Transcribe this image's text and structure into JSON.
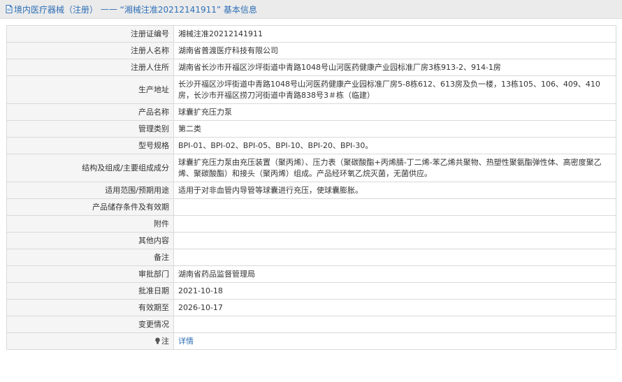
{
  "header": {
    "prefix": "境内医疗器械（注册）",
    "separator": " —— ",
    "title": "“湘械注准20212141911” 基本信息"
  },
  "rows": [
    {
      "label": "注册证编号",
      "value": "湘械注准20212141911"
    },
    {
      "label": "注册人名称",
      "value": "湖南省普渡医疗科技有限公司"
    },
    {
      "label": "注册人住所",
      "value": "湖南省长沙市开福区沙坪街道中青路1048号山河医药健康产业园标准厂房3栋913-2、914-1房"
    },
    {
      "label": "生产地址",
      "value": "长沙开福区沙坪街道中青路1048号山河医药健康产业园标准厂房5-8栋612、613房及负一楼，13栋105、106、409、410房，长沙市开福区捞刀河街道中青路838号3＃栋（临建）"
    },
    {
      "label": "产品名称",
      "value": "球囊扩充压力泵"
    },
    {
      "label": "管理类别",
      "value": "第二类"
    },
    {
      "label": "型号规格",
      "value": "BPI-01、BPI-02、BPI-05、BPI-10、BPI-20、BPI-30。"
    },
    {
      "label": "结构及组成/主要组成成分",
      "value": "球囊扩充压力泵由充压装置（聚丙烯）、压力表（聚碳酸酯+丙烯腈-丁二烯-苯乙烯共聚物、热塑性聚氨酯弹性体、高密度聚乙烯、聚碳酸酯）和接头（聚丙烯）组成。产品经环氧乙烷灭菌，无菌供应。"
    },
    {
      "label": "适用范围/预期用途",
      "value": "适用于对非血管内导管等球囊进行充压，使球囊膨胀。"
    },
    {
      "label": "产品储存条件及有效期",
      "value": ""
    },
    {
      "label": "附件",
      "value": ""
    },
    {
      "label": "其他内容",
      "value": ""
    },
    {
      "label": "备注",
      "value": ""
    },
    {
      "label": "审批部门",
      "value": "湖南省药品监督管理局"
    },
    {
      "label": "批准日期",
      "value": "2021-10-18"
    },
    {
      "label": "有效期至",
      "value": "2026-10-17"
    },
    {
      "label": "变更情况",
      "value": ""
    }
  ],
  "note": {
    "label": "注",
    "link": "详情"
  }
}
